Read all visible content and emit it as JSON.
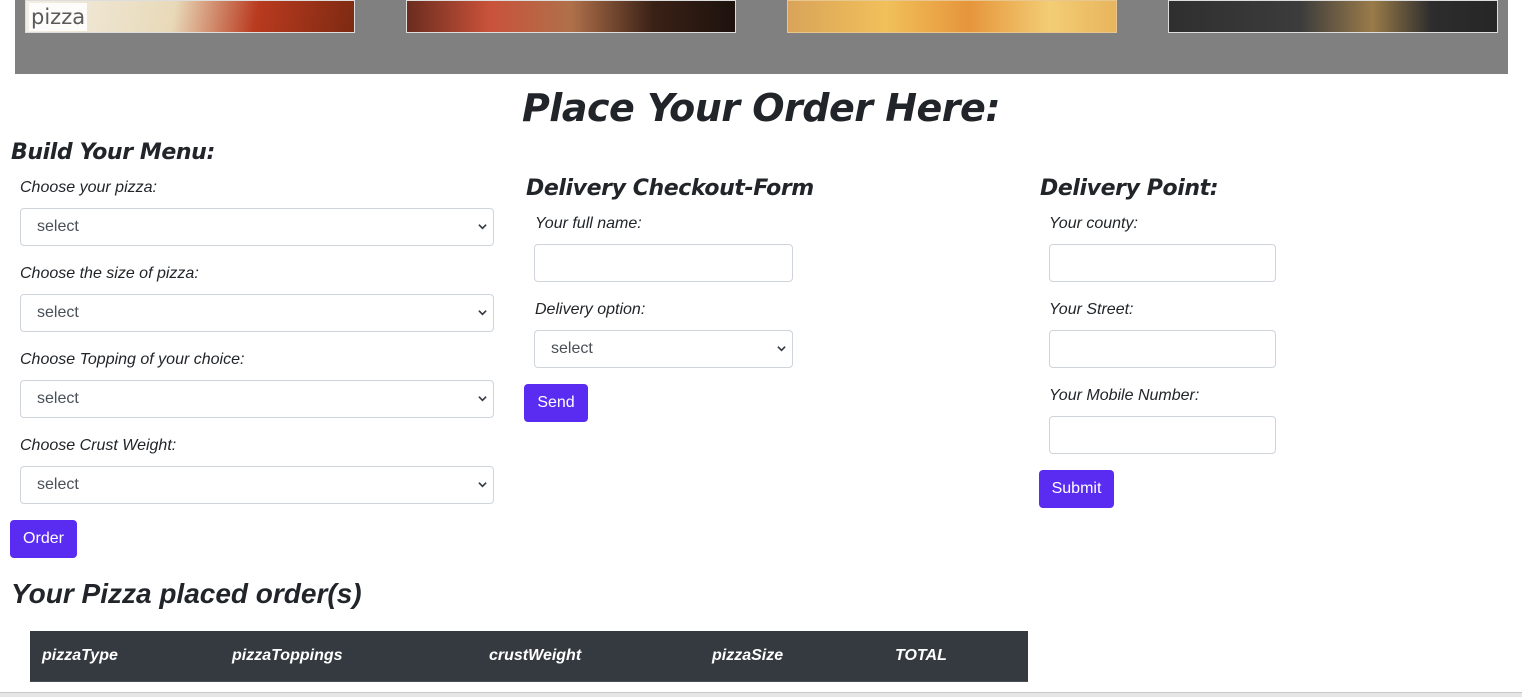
{
  "gallery": {
    "first_caption": "pizza"
  },
  "page_title": "Place Your Order Here:",
  "menu": {
    "heading": "Build Your Menu:",
    "pizza_label": "Choose your pizza:",
    "pizza_value": "select",
    "size_label": "Choose the size of pizza:",
    "size_value": "select",
    "topping_label": "Choose Topping of your choice:",
    "topping_value": "select",
    "crust_label": "Choose Crust Weight:",
    "crust_value": "select",
    "order_button": "Order"
  },
  "checkout": {
    "heading": "Delivery Checkout-Form",
    "name_label": "Your full name:",
    "name_value": "",
    "delivery_label": "Delivery option:",
    "delivery_value": "select",
    "send_button": "Send"
  },
  "delivery_point": {
    "heading": "Delivery Point:",
    "county_label": "Your county:",
    "county_value": "",
    "street_label": "Your Street:",
    "street_value": "",
    "mobile_label": "Your Mobile Number:",
    "mobile_value": "",
    "submit_button": "Submit"
  },
  "orders": {
    "heading": "Your Pizza placed order(s)",
    "columns": [
      "pizzaType",
      "pizzaToppings",
      "crustWeight",
      "pizzaSize",
      "TOTAL"
    ]
  },
  "colors": {
    "accent": "#5a2cf2",
    "table_header": "#343a40",
    "gallery_bg": "#808080"
  }
}
